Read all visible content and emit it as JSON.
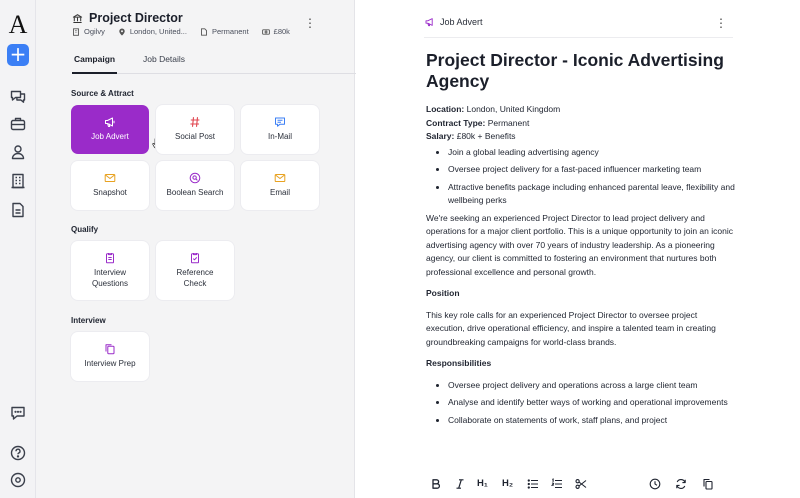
{
  "app": {
    "logo": "A",
    "new_label": "+"
  },
  "rail": {
    "icons": [
      "chat-icon",
      "briefcase-icon",
      "user-icon",
      "building-icon",
      "document-icon",
      "feedback-icon",
      "help-icon",
      "settings-icon"
    ]
  },
  "job": {
    "title": "Project Director",
    "company": "Ogilvy",
    "location": "London, United...",
    "contract": "Permanent",
    "salary": "£80k"
  },
  "tabs": [
    {
      "label": "Campaign",
      "active": true
    },
    {
      "label": "Job Details",
      "active": false
    }
  ],
  "sections": {
    "source": "Source & Attract",
    "qualify": "Qualify",
    "interview": "Interview"
  },
  "cards": {
    "job_advert": {
      "label": "Job Advert",
      "icon": "megaphone-icon"
    },
    "social_post": {
      "label": "Social Post",
      "icon": "hash-icon"
    },
    "in_mail": {
      "label": "In-Mail",
      "icon": "message-icon"
    },
    "snapshot": {
      "label": "Snapshot",
      "icon": "mail-icon"
    },
    "boolean_search": {
      "label": "Boolean Search",
      "icon": "search-circle-icon"
    },
    "email": {
      "label": "Email",
      "icon": "mail-icon"
    },
    "interview_questions": {
      "label1": "Interview",
      "label2": "Questions",
      "icon": "clipboard-icon"
    },
    "reference_check": {
      "label1": "Reference",
      "label2": "Check",
      "icon": "clipboard-check-icon"
    },
    "interview_prep": {
      "label": "Interview Prep",
      "icon": "copy-icon"
    }
  },
  "colors": {
    "accent": "#9a2bc9",
    "primary": "#3b7ff5",
    "hash": "#e0454f",
    "mail": "#e8a221",
    "message": "#3b7ff5"
  },
  "doc": {
    "header": "Job Advert",
    "title": "Project Director - Iconic Advertising Agency",
    "location_label": "Location:",
    "location_value": " London, United Kingdom",
    "contract_label": "Contract Type:",
    "contract_value": " Permanent",
    "salary_label": "Salary:",
    "salary_value": " £80k + Benefits",
    "bullets1": [
      "Join a global leading advertising agency",
      "Oversee project delivery for a fast-paced influencer marketing team",
      "Attractive benefits package including enhanced parental leave, flexibility and wellbeing perks"
    ],
    "intro": "We're seeking an experienced Project Director to lead project delivery and operations for a major client portfolio. This is a unique opportunity to join an iconic advertising agency with over 70 years of industry leadership. As a pioneering agency, our client is committed to fostering an environment that nurtures both professional excellence and personal growth.",
    "position_heading": "Position",
    "position_text": "This key role calls for an experienced Project Director to oversee project execution, drive operational efficiency, and inspire a talented team in creating groundbreaking campaigns for world-class brands.",
    "responsibilities_heading": "Responsibilities",
    "bullets2": [
      "Oversee project delivery and operations across a large client team",
      "Analyse and identify better ways of working and operational improvements",
      "Collaborate on statements of work, staff plans, and project"
    ]
  },
  "toolbar": {
    "h1": "H₁",
    "h2": "H₂"
  }
}
